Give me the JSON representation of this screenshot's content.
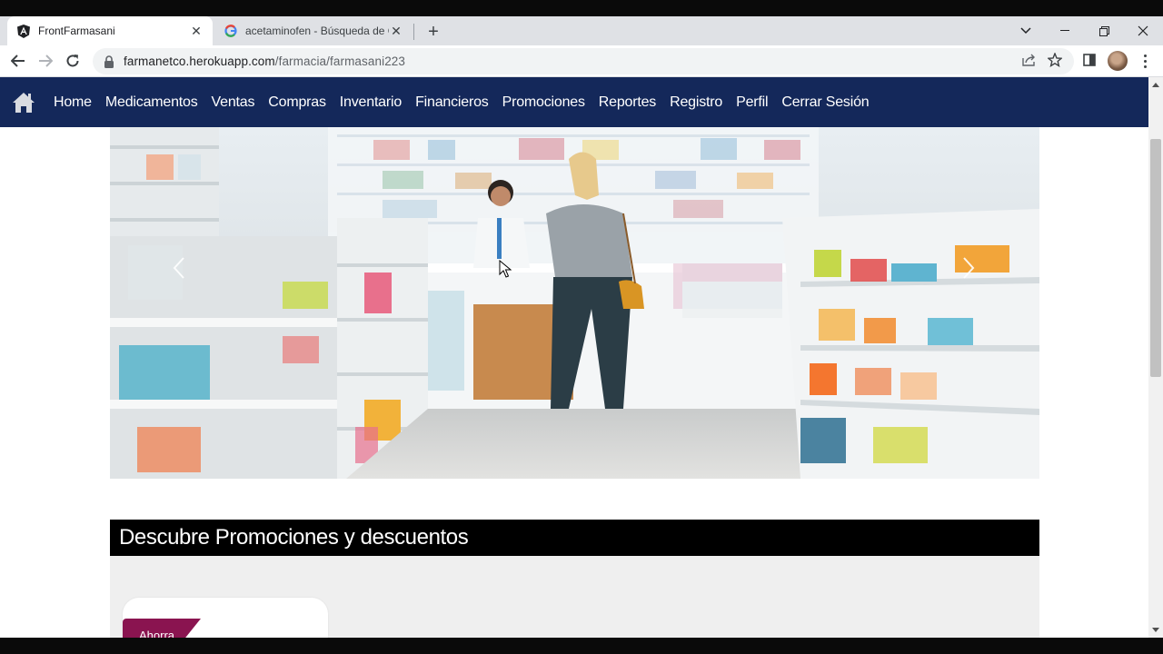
{
  "browser": {
    "tabs": [
      {
        "title": "FrontFarmasani",
        "favicon": "angular-icon",
        "active": true
      },
      {
        "title": "acetaminofen - Búsqueda de Goo",
        "favicon": "google-icon",
        "active": false
      }
    ],
    "url_host": "farmanetco.herokuapp.com",
    "url_path": "/farmacia/farmasani223"
  },
  "navbar": {
    "logo": "home-icon",
    "items": [
      "Home",
      "Medicamentos",
      "Ventas",
      "Compras",
      "Inventario",
      "Financieros",
      "Promociones",
      "Reportes",
      "Registro",
      "Perfil",
      "Cerrar Sesión"
    ],
    "background": "#14285a"
  },
  "carousel": {
    "image": "pharmacy-counter-scene",
    "prev": "chevron-left-icon",
    "next": "chevron-right-icon"
  },
  "promotions": {
    "heading": "Descubre Promociones y descuentos",
    "card_ribbon": "Ahorra",
    "ribbon_color": "#8a1450"
  }
}
